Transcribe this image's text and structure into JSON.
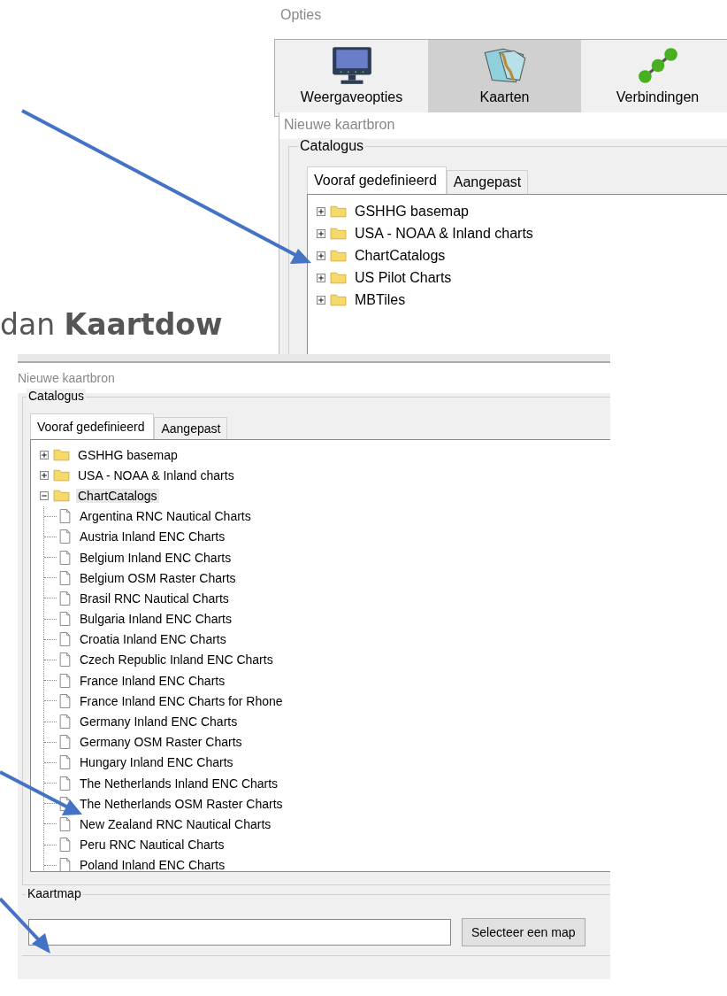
{
  "top_screenshot": {
    "window_title": "Opties",
    "toolbar": [
      {
        "label": "Weergaveopties",
        "selected": false,
        "kind": "display"
      },
      {
        "label": "Kaarten",
        "selected": true,
        "kind": "charts"
      },
      {
        "label": "Verbindingen",
        "selected": false,
        "kind": "connections"
      }
    ],
    "dialog": {
      "title": "Nieuwe kaartbron",
      "group": "Catalogus",
      "tabs": [
        {
          "label": "Vooraf gedefinieerd",
          "selected": true
        },
        {
          "label": "Aangepast",
          "selected": false
        }
      ],
      "tree": [
        {
          "label": "GSHHG basemap",
          "expanded": false,
          "selected": false
        },
        {
          "label": "USA - NOAA & Inland charts",
          "expanded": false,
          "selected": false
        },
        {
          "label": "ChartCatalogs",
          "expanded": false,
          "selected": false
        },
        {
          "label": "US Pilot Charts",
          "expanded": false,
          "selected": false
        },
        {
          "label": "MBTiles",
          "expanded": false,
          "selected": false
        }
      ]
    }
  },
  "caption": "dan **Kaartdow**",
  "bottom_screenshot": {
    "dialog": {
      "title": "Nieuwe kaartbron",
      "group": "Catalogus",
      "tabs": [
        {
          "label": "Vooraf gedefinieerd",
          "selected": true
        },
        {
          "label": "Aangepast",
          "selected": false
        }
      ],
      "tree": [
        {
          "label": "GSHHG basemap",
          "expanded": false,
          "selected": false
        },
        {
          "label": "USA - NOAA & Inland charts",
          "expanded": false,
          "selected": false
        },
        {
          "label": "ChartCatalogs",
          "expanded": true,
          "selected": true,
          "children": [
            {
              "label": "Argentina RNC Nautical Charts"
            },
            {
              "label": "Austria Inland ENC Charts"
            },
            {
              "label": "Belgium Inland ENC Charts"
            },
            {
              "label": "Belgium OSM Raster Charts"
            },
            {
              "label": "Brasil RNC Nautical Charts"
            },
            {
              "label": "Bulgaria Inland ENC Charts"
            },
            {
              "label": "Croatia Inland ENC Charts"
            },
            {
              "label": "Czech Republic Inland ENC Charts"
            },
            {
              "label": "France Inland ENC Charts"
            },
            {
              "label": "France Inland ENC Charts for Rhone"
            },
            {
              "label": "Germany Inland ENC Charts"
            },
            {
              "label": "Germany OSM Raster Charts"
            },
            {
              "label": "Hungary Inland ENC Charts"
            },
            {
              "label": "The Netherlands Inland ENC Charts"
            },
            {
              "label": "The Netherlands OSM Raster Charts"
            },
            {
              "label": "New Zealand RNC Nautical Charts"
            },
            {
              "label": "Peru RNC Nautical Charts"
            },
            {
              "label": "Poland Inland ENC Charts"
            }
          ]
        }
      ]
    },
    "folder_group": {
      "label": "Kaartmap",
      "button": "Selecteer een map"
    }
  }
}
